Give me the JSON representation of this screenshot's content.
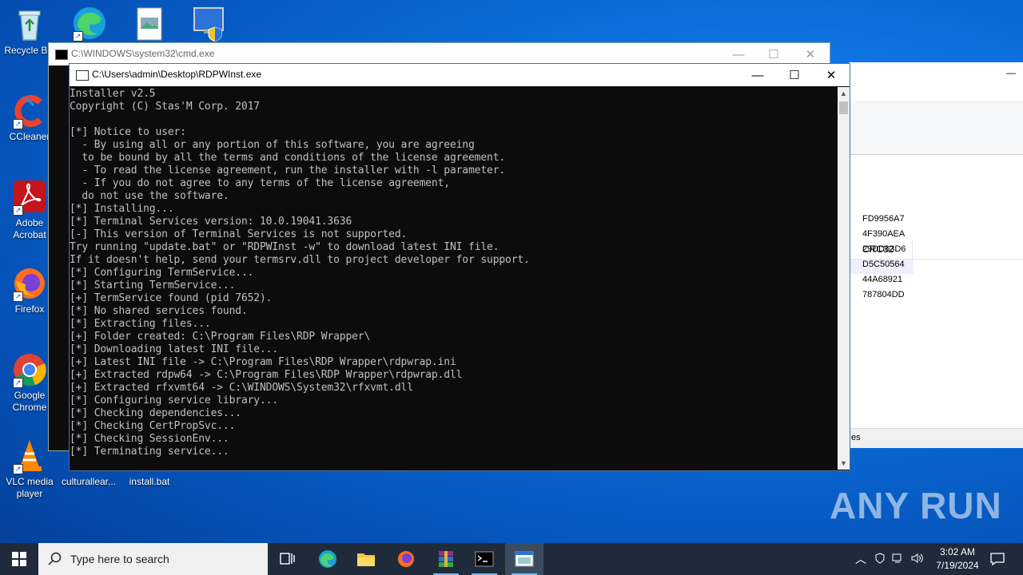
{
  "desktop": {
    "icons": [
      {
        "label": "Recycle Bin",
        "icon": "recycle-bin-icon"
      },
      {
        "label": "",
        "icon": "edge-icon"
      },
      {
        "label": "",
        "icon": "document-icon"
      },
      {
        "label": "",
        "icon": "security-shield-icon"
      },
      {
        "label": "CCleaner",
        "icon": "ccleaner-icon"
      },
      {
        "label": "Adobe Acrobat",
        "icon": "acrobat-icon"
      },
      {
        "label": "Firefox",
        "icon": "firefox-icon"
      },
      {
        "label": "Google Chrome",
        "icon": "chrome-icon"
      },
      {
        "label": "VLC media player",
        "icon": "vlc-icon"
      },
      {
        "label": "culturallear...",
        "icon": "file-icon"
      },
      {
        "label": "install.bat",
        "icon": "batch-file-icon"
      }
    ]
  },
  "background_window": {
    "column_header": "CRC32",
    "crc_values": [
      "FD9956A7",
      "4F390AEA",
      "29DD63D6",
      "D5C50564",
      "44A68921",
      "787804DD"
    ],
    "status_fragment": "es"
  },
  "cmd_window": {
    "title": "C:\\WINDOWS\\system32\\cmd.exe"
  },
  "main_window": {
    "title": "C:\\Users\\admin\\Desktop\\RDPWInst.exe",
    "console_lines": [
      "Installer v2.5",
      "Copyright (C) Stas'M Corp. 2017",
      "",
      "[*] Notice to user:",
      "  - By using all or any portion of this software, you are agreeing",
      "  to be bound by all the terms and conditions of the license agreement.",
      "  - To read the license agreement, run the installer with -l parameter.",
      "  - If you do not agree to any terms of the license agreement,",
      "  do not use the software.",
      "[*] Installing...",
      "[*] Terminal Services version: 10.0.19041.3636",
      "[-] This version of Terminal Services is not supported.",
      "Try running \"update.bat\" or \"RDPWInst -w\" to download latest INI file.",
      "If it doesn't help, send your termsrv.dll to project developer for support.",
      "[*] Configuring TermService...",
      "[*] Starting TermService...",
      "[+] TermService found (pid 7652).",
      "[*] No shared services found.",
      "[*] Extracting files...",
      "[+] Folder created: C:\\Program Files\\RDP Wrapper\\",
      "[*] Downloading latest INI file...",
      "[+] Latest INI file -> C:\\Program Files\\RDP Wrapper\\rdpwrap.ini",
      "[+] Extracted rdpw64 -> C:\\Program Files\\RDP Wrapper\\rdpwrap.dll",
      "[+] Extracted rfxvmt64 -> C:\\WINDOWS\\System32\\rfxvmt.dll",
      "[*] Configuring service library...",
      "[*] Checking dependencies...",
      "[*] Checking CertPropSvc...",
      "[*] Checking SessionEnv...",
      "[*] Terminating service..."
    ]
  },
  "watermark": "ANY RUN",
  "taskbar": {
    "search_placeholder": "Type here to search",
    "time": "3:02 AM",
    "date": "7/19/2024"
  }
}
